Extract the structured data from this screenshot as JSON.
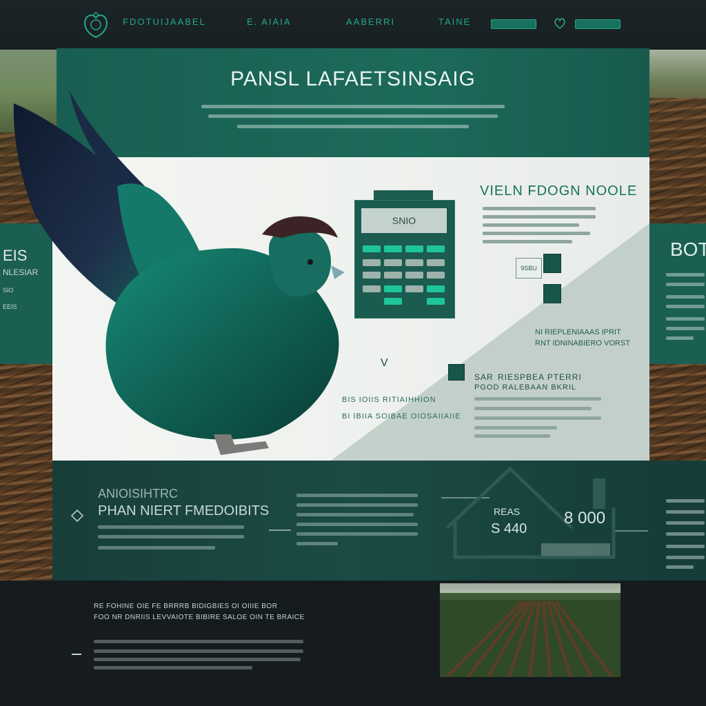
{
  "nav": {
    "links": [
      "FDOTUIJAABEL",
      "E. AIAIA",
      "AABERRI",
      "TAINE"
    ]
  },
  "hero": {
    "title": "PANSL LAFAETSINSAIG"
  },
  "left_panel": {
    "lines": [
      "EIS",
      "NLESIAR",
      "SIO",
      "EEIS"
    ]
  },
  "right_panel": {
    "title": "BOTT"
  },
  "feature": {
    "title": "VIELN FDOGN NOOLE",
    "note": "NI RIEPLENIAAAS IPRIT\nRNT IDNINABIERO VORST",
    "chip_label": "9SBU",
    "arrow_label": "V"
  },
  "calculator": {
    "display": "SNIO",
    "key_colors": [
      "#1fc59a",
      "#1fc59a",
      "#1fc59a",
      "#1fc59a",
      "#9fb3ad",
      "#9fb3ad",
      "#9fb3ad",
      "#9fb3ad",
      "#9fb3ad",
      "#9fb3ad",
      "#9fb3ad",
      "#9fb3ad",
      "#9fb3ad",
      "#1fc59a",
      "#9fb3ad",
      "#1fc59a"
    ]
  },
  "chicken_caption": {
    "line1": "BIS IOIIS RITIAIHHION",
    "line2": "BI IBIIA SOIBAE OIOSAIIAIIE"
  },
  "side_info": {
    "title1": "SAR",
    "title1b": "RIESPBEA PTERRI",
    "title2": "PGOD RALEBAAN BKRIL"
  },
  "mid": {
    "heading_top": "ANIOISIHTRC",
    "heading_main": "PHAN NIERT FMEDOIBITS",
    "house_label": "REAS",
    "house_value": "S 440",
    "big_value": "8 000"
  },
  "bottom": {
    "line1": "RE FOHINE OIE FE BRRRB BIDIGBIES OI OIIIE BOR",
    "line2": "FOO NR DNRIIS LEVVAIOTE BIBIRE SALOE OIN TE BRAICE"
  },
  "colors": {
    "accent": "#1fc59a",
    "teal_dark": "#18564b",
    "bg": "#161c1e"
  }
}
